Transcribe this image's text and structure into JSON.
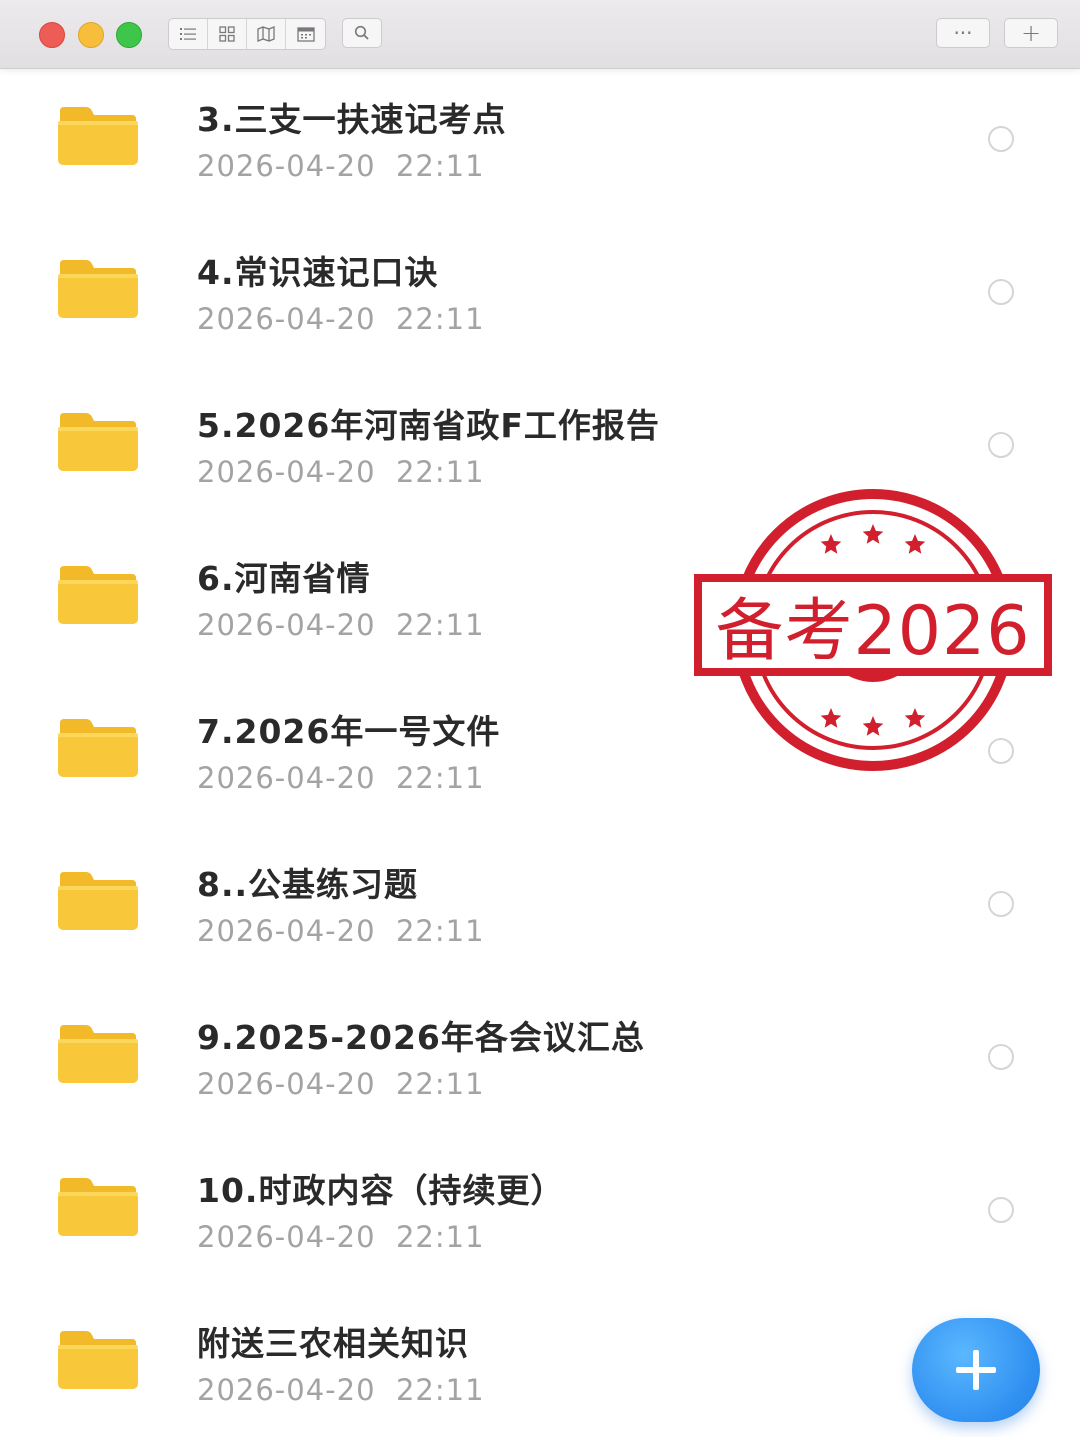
{
  "toolbar": {
    "view_buttons": [
      {
        "icon": "list-view-icon"
      },
      {
        "icon": "grid-view-icon"
      },
      {
        "icon": "map-view-icon"
      },
      {
        "icon": "calendar-view-icon"
      }
    ],
    "search_icon": "search-icon",
    "more_label": "···",
    "add_label": "+"
  },
  "files": [
    {
      "name": "3.三支一扶速记考点",
      "date": "2026-04-20  22:11"
    },
    {
      "name": "4.常识速记口诀",
      "date": "2026-04-20  22:11"
    },
    {
      "name": "5.2026年河南省政F工作报告",
      "date": "2026-04-20  22:11"
    },
    {
      "name": "6.河南省情",
      "date": "2026-04-20  22:11"
    },
    {
      "name": "7.2026年一号文件",
      "date": "2026-04-20  22:11"
    },
    {
      "name": "8..公基练习题",
      "date": "2026-04-20  22:11"
    },
    {
      "name": "9.2025-2026年各会议汇总",
      "date": "2026-04-20  22:11"
    },
    {
      "name": "10.时政内容（持续更）",
      "date": "2026-04-20  22:11"
    },
    {
      "name": "附送三农相关知识",
      "date": "2026-04-20  22:11"
    }
  ],
  "stamp": {
    "text": "备考2026",
    "color": "#d21f2d"
  },
  "fab": {
    "icon": "plus-icon",
    "color": "#2f8ff0"
  },
  "colors": {
    "folder": "#f8c83a",
    "title_text": "#2a2a2a",
    "date_text": "#a3a3a3"
  }
}
